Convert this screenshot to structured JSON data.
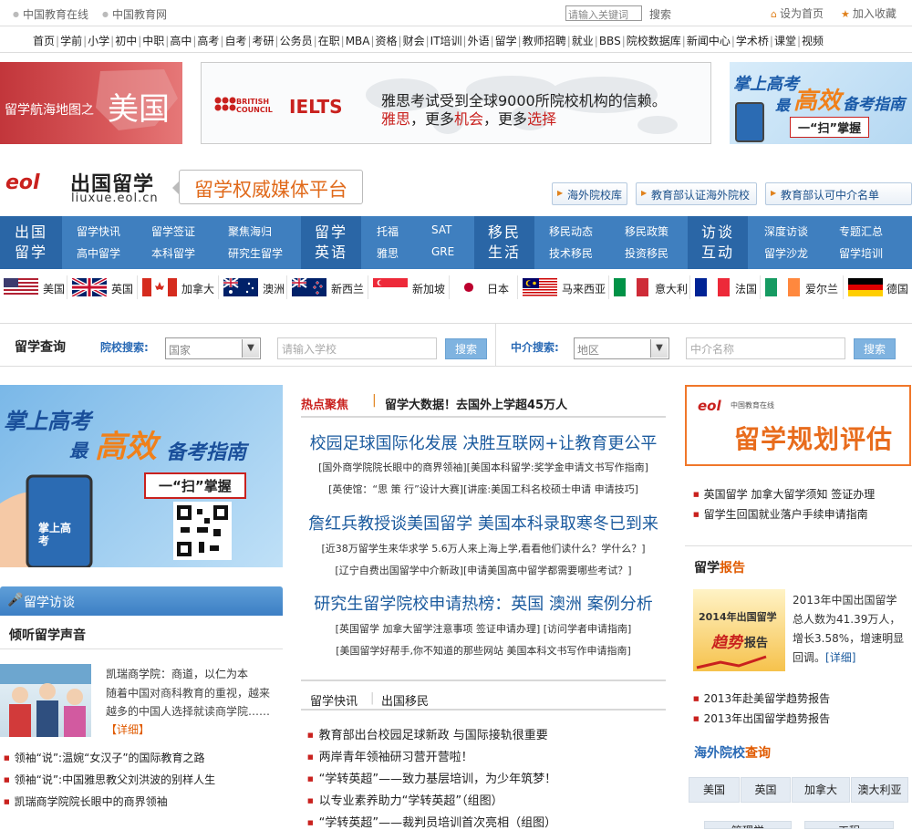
{
  "topbar": {
    "site1": "中国教育在线",
    "site2": "中国教育网",
    "search_placeholder": "请输入关键词",
    "search_label": "搜索",
    "set_home": "设为首页",
    "add_fav": "加入收藏"
  },
  "nav": {
    "items": [
      "首页",
      "学前",
      "小学",
      "初中",
      "中职",
      "高中",
      "高考",
      "自考",
      "考研",
      "公务员",
      "在职",
      "MBA",
      "资格",
      "财会",
      "IT培训",
      "外语",
      "留学",
      "教师招聘",
      "就业",
      "BBS",
      "院校数据库",
      "新闻中心",
      "学术桥",
      "课堂",
      "视频"
    ]
  },
  "banners": {
    "left_text1": "留学航海地图之",
    "left_text2": "美国",
    "ielts_bc": "BRITISH COUNCIL",
    "ielts_logo": "IELTS",
    "ielts_line1": "雅思考试受到全球9000所院校机构的信赖。",
    "ielts_line2_a": "雅思",
    "ielts_line2_b": "，更多",
    "ielts_line2_c": "机会",
    "ielts_line2_d": "，更多",
    "ielts_line2_e": "选择",
    "right_text1": "掌上高考",
    "right_text2": "最",
    "right_text3": "高效",
    "right_text4": "备考指南",
    "right_text5": "一“扫”掌握"
  },
  "header": {
    "logo_mark": "eol",
    "title": "出国留学",
    "url": "liuxue.eol.cn",
    "slogan": "留学权威媒体平台",
    "btn1": "海外院校库",
    "btn2": "教育部认证海外院校",
    "btn3": "教育部认可中介名单"
  },
  "categories": [
    {
      "main1": "出国",
      "main2": "留学",
      "subs": [
        "留学快讯",
        "留学签证",
        "聚焦海归",
        "高中留学",
        "本科留学",
        "研究生留学"
      ]
    },
    {
      "main1": "留学",
      "main2": "英语",
      "subs": [
        "托福",
        "SAT",
        "雅思",
        "GRE"
      ]
    },
    {
      "main1": "移民",
      "main2": "生活",
      "subs": [
        "移民动态",
        "移民政策",
        "技术移民",
        "投资移民"
      ]
    },
    {
      "main1": "访谈",
      "main2": "互动",
      "subs": [
        "深度访谈",
        "专题汇总",
        "留学沙龙",
        "留学培训"
      ]
    }
  ],
  "flags": [
    "美国",
    "英国",
    "加拿大",
    "澳洲",
    "新西兰",
    "新加坡",
    "日本",
    "马来西亚",
    "意大利",
    "法国",
    "爱尔兰",
    "德国"
  ],
  "search": {
    "title": "留学查询",
    "school_label": "院校搜索:",
    "country_select": "国家",
    "school_placeholder": "请输入学校",
    "btn": "搜索",
    "agency_label": "中介搜索:",
    "region_select": "地区",
    "agency_placeholder": "中介名称"
  },
  "left": {
    "banner_t1": "掌上高考",
    "banner_t2": "最",
    "banner_t3": "高效",
    "banner_t4": "备考指南",
    "banner_t5": "一“扫”掌握",
    "banner_phone": "掌上高考",
    "fangtan_title": "留学访谈",
    "fangtan_sub": "倾听留学声音",
    "story_title": "凯瑞商学院：商道，以仁为本",
    "story_desc": "随着中国对商科教育的重视，越来越多的中国人选择就读商学院……",
    "story_more": "【详细】",
    "list": [
      "领袖“说”:温婉“女汉子”的国际教育之路",
      "领袖“说”:中国雅思教父刘洪波的别样人生",
      "凯瑞商学院院长眼中的商界领袖"
    ]
  },
  "middle": {
    "hot_label": "热点聚焦",
    "hot_title": "留学大数据！去国外上学超45万人",
    "headlines": [
      {
        "title": "校园足球国际化发展 决胜互联网+让教育更公平",
        "subs": [
          "[国外商学院院长眼中的商界领袖][美国本科留学:奖学金申请文书写作指南]",
          "[英使馆：“思 策 行”设计大赛][讲座:美国工科名校硕士申请 申请技巧]"
        ]
      },
      {
        "title": "詹红兵教授谈美国留学 美国本科录取寒冬已到来",
        "subs": [
          "[近38万留学生来华求学 5.6万人来上海上学,看看他们读什么？学什么？]",
          "[辽宁自费出国留学中介新政][申请美国高中留学都需要哪些考试？]"
        ]
      },
      {
        "title": "研究生留学院校申请热榜：英国 澳洲 案例分析",
        "subs": [
          "[英国留学 加拿大留学注意事项 签证申请办理] [访问学者申请指南]",
          "[美国留学好帮手,你不知道的那些网站 美国本科文书写作申请指南]"
        ]
      }
    ],
    "tabs": [
      "留学快讯",
      "出国移民"
    ],
    "list": [
      "教育部出台校园足球新政 与国际接轨很重要",
      "两岸青年领袖研习营开营啦！",
      "“学转英超”——致力基层培训，为少年筑梦！",
      "以专业素养助力“学转英超”（组图）",
      "“学转英超”——裁判员培训首次亮相（组图）"
    ]
  },
  "right": {
    "eval_brand": "eol",
    "eval_brand2": "中国教育在线",
    "eval_title": "留学规划评估",
    "list1": [
      "英国留学 加拿大留学须知 签证办理",
      "留学生回国就业落户手续申请指南"
    ],
    "report_title_a": "留学",
    "report_title_b": "报告",
    "report_img_t1": "2014年出国留学",
    "report_img_t2": "趋势",
    "report_img_t3": "报告",
    "report_text": "2013年中国出国留学总人数为41.39万人，增长3.58%，增速明显回调。",
    "report_more": "[详细]",
    "list2": [
      "2013年赴美留学趋势报告",
      "2013年出国留学趋势报告"
    ],
    "hw_title_a": "海外院校",
    "hw_title_b": "查询",
    "countries": [
      "美国",
      "英国",
      "加拿大",
      "澳大利亚"
    ],
    "row2": [
      "管理学",
      "工程"
    ]
  }
}
